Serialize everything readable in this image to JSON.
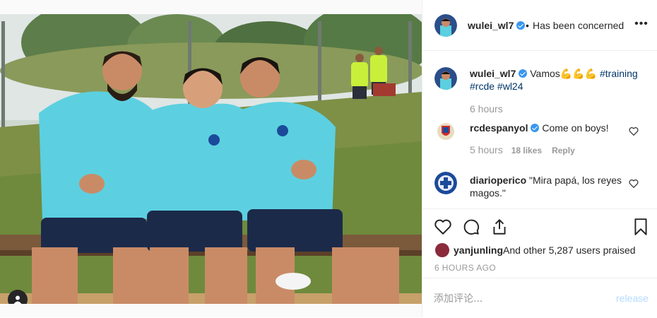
{
  "post": {
    "author": "wulei_wl7",
    "follow_separator": "•",
    "follow_status": "Has been concerned",
    "more_options": "•••"
  },
  "comments": [
    {
      "user": "wulei_wl7",
      "verified": true,
      "text": "Vamos",
      "emoji": "💪💪💪",
      "hashtags": [
        "#training",
        "#rcde",
        "#wl24"
      ],
      "time": "6 hours"
    },
    {
      "user": "rcdespanyol",
      "verified": true,
      "text": "Come on boys!",
      "time": "5 hours",
      "likes": "18 likes",
      "reply": "Reply"
    },
    {
      "user": "diarioperico",
      "verified": false,
      "text": "\"Mira papá, los reyes magos.\""
    }
  ],
  "liked_by": {
    "user": "yanjunling",
    "rest": "And other 5,287 users praised"
  },
  "timestamp": "6 HOURS AGO",
  "comment_form": {
    "placeholder": "添加评论...",
    "submit_label": "release"
  },
  "icons": {
    "like": "heart-icon",
    "comment": "comment-icon",
    "share": "share-icon",
    "save": "bookmark-icon",
    "tag": "user-tag-icon"
  },
  "colors": {
    "verified": "#3897f0",
    "hashtag": "#003569",
    "secondary_text": "#999999",
    "post_button_disabled": "#b3dbff",
    "jersey": "#5cd0e0"
  }
}
